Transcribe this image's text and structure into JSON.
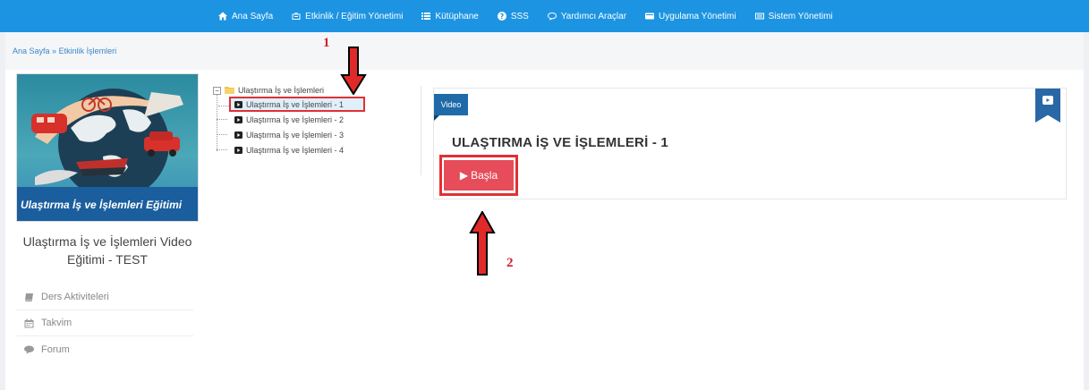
{
  "nav": {
    "items": [
      {
        "label": "Ana Sayfa",
        "icon": "home-icon"
      },
      {
        "label": "Etkinlik / Eğitim Yönetimi",
        "icon": "briefcase-icon"
      },
      {
        "label": "Kütüphane",
        "icon": "list-icon"
      },
      {
        "label": "SSS",
        "icon": "question-circle-icon"
      },
      {
        "label": "Yardımcı Araçlar",
        "icon": "comment-icon"
      },
      {
        "label": "Uygulama Yönetimi",
        "icon": "card-icon"
      },
      {
        "label": "Sistem Yönetimi",
        "icon": "card-list-icon"
      }
    ]
  },
  "breadcrumb": {
    "home": "Ana Sayfa",
    "separator": "»",
    "current": "Etkinlik İşlemleri"
  },
  "course": {
    "cover_caption": "Ulaştırma İş ve İşlemleri Eğitimi",
    "title": "Ulaştırma İş ve İşlemleri Video Eğitimi - TEST"
  },
  "side_menu": [
    {
      "label": "Ders Aktiviteleri",
      "icon": "book-icon"
    },
    {
      "label": "Takvim",
      "icon": "calendar-icon"
    },
    {
      "label": "Forum",
      "icon": "comment-icon"
    }
  ],
  "tree": {
    "root": {
      "label": "Ulaştırma İş ve İşlemleri",
      "expander": "−"
    },
    "children": [
      {
        "label": "Ulaştırma İş ve İşlemleri - 1",
        "selected": true
      },
      {
        "label": "Ulaştırma İş ve İşlemleri - 2",
        "selected": false
      },
      {
        "label": "Ulaştırma İş ve İşlemleri - 3",
        "selected": false
      },
      {
        "label": "Ulaştırma İş ve İşlemleri - 4",
        "selected": false
      }
    ]
  },
  "video": {
    "tag": "Video",
    "title": "ULAŞTIRMA İŞ VE İŞLEMLERİ - 1",
    "start_label": "Başla",
    "start_glyph": "▶"
  },
  "annotations": {
    "step1": "1",
    "step2": "2"
  },
  "colors": {
    "nav": "#1d94e2",
    "accent_red": "#e03035",
    "button": "#e64c5a",
    "tag": "#1f6aa8"
  }
}
